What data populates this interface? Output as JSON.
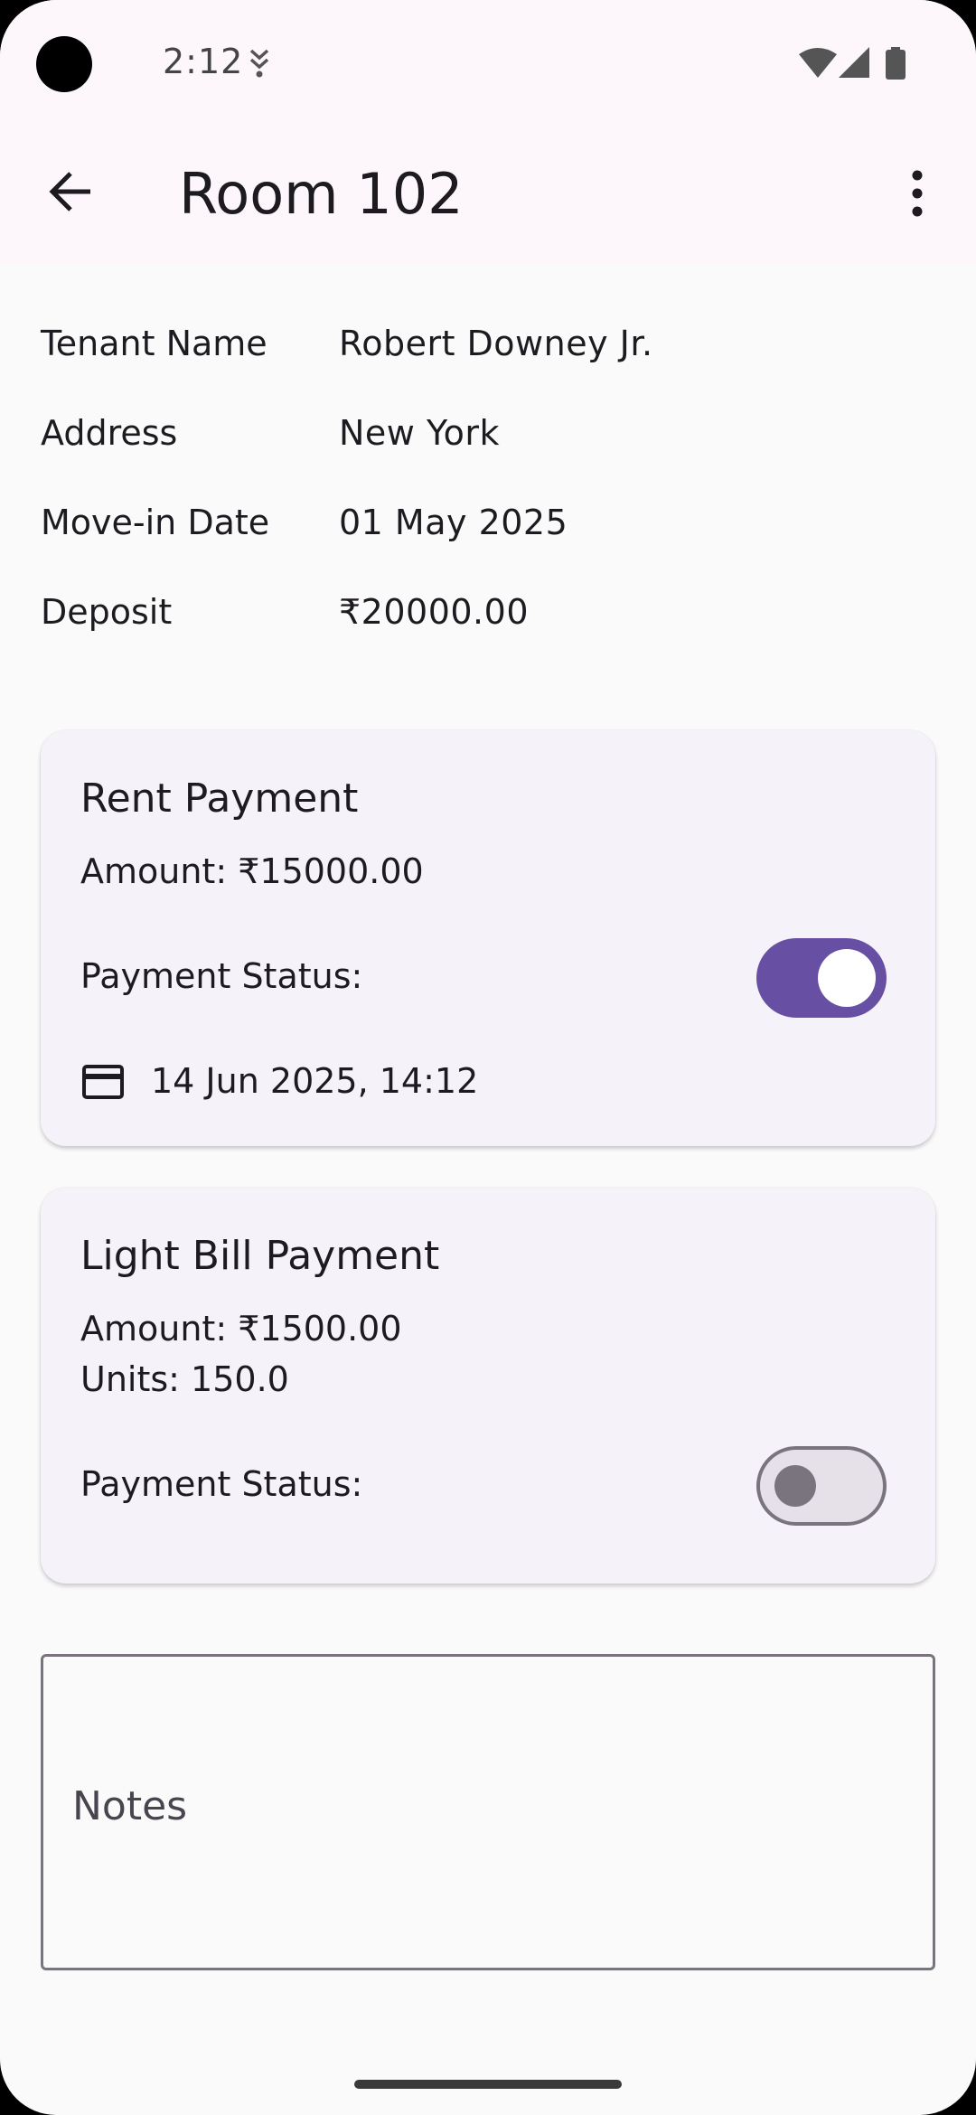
{
  "status_bar": {
    "time": "2:12",
    "icons": [
      "camera-cutout",
      "download-icon",
      "wifi-icon",
      "signal-icon",
      "battery-icon"
    ]
  },
  "app_bar": {
    "title": "Room 102",
    "back_icon": "arrow-back-icon",
    "more_icon": "more-vert-icon"
  },
  "tenant": {
    "rows": [
      {
        "label": "Tenant Name",
        "value": "Robert Downey Jr."
      },
      {
        "label": "Address",
        "value": "New York"
      },
      {
        "label": "Move-in Date",
        "value": "01 May 2025"
      },
      {
        "label": "Deposit",
        "value": "₹20000.00"
      }
    ]
  },
  "rent_card": {
    "title": "Rent Payment",
    "amount": "Amount: ₹15000.00",
    "status_label": "Payment Status:",
    "status_on": true,
    "paid_at": "14 Jun 2025, 14:12",
    "paid_icon": "credit-card-icon"
  },
  "light_card": {
    "title": "Light Bill Payment",
    "amount": "Amount: ₹1500.00",
    "units": "Units: 150.0",
    "status_label": "Payment Status:",
    "status_on": false
  },
  "notes": {
    "label": "Notes",
    "value": ""
  },
  "colors": {
    "primary": "#6750a4",
    "surface": "#fbfafb",
    "card": "#f6f2f9",
    "outline": "#79747e"
  }
}
